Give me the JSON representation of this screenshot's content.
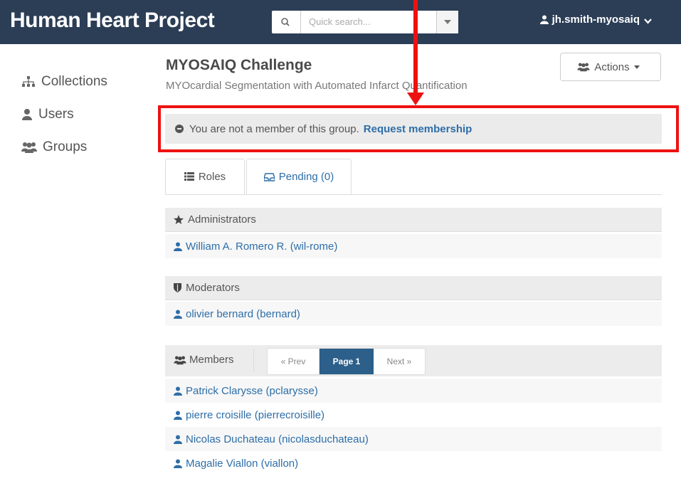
{
  "header": {
    "brand": "Human Heart Project",
    "search_placeholder": "Quick search...",
    "user": "jh.smith-myosaiq"
  },
  "sidebar": {
    "items": [
      {
        "label": "Collections",
        "icon": "sitemap-icon"
      },
      {
        "label": "Users",
        "icon": "user-icon"
      },
      {
        "label": "Groups",
        "icon": "group-icon"
      }
    ]
  },
  "group": {
    "title": "MYOSAIQ Challenge",
    "subtitle": "MYOcardial Segmentation with Automated Infarct Quantification",
    "actions_label": "Actions"
  },
  "notice": {
    "text": "You are not a member of this group.",
    "link": "Request membership"
  },
  "tabs": [
    {
      "label": "Roles",
      "icon": "list-icon"
    },
    {
      "label": "Pending (0)",
      "icon": "inbox-icon"
    }
  ],
  "administrators": {
    "title": "Administrators",
    "users": [
      "William A. Romero R. (wil-rome)"
    ]
  },
  "moderators": {
    "title": "Moderators",
    "users": [
      "olivier bernard (bernard)"
    ]
  },
  "members": {
    "title": "Members",
    "pager": {
      "prev": "« Prev",
      "current": "Page 1",
      "next": "Next »"
    },
    "users": [
      "Patrick Clarysse (pclarysse)",
      "pierre croisille (pierrecroisille)",
      "Nicolas Duchateau (nicolasduchateau)",
      "Magalie Viallon (viallon)"
    ]
  },
  "colors": {
    "header_bg": "#2c3e56",
    "link": "#2d6ea8",
    "annotation": "#ee1111",
    "pager_active": "#2c5f8a"
  }
}
